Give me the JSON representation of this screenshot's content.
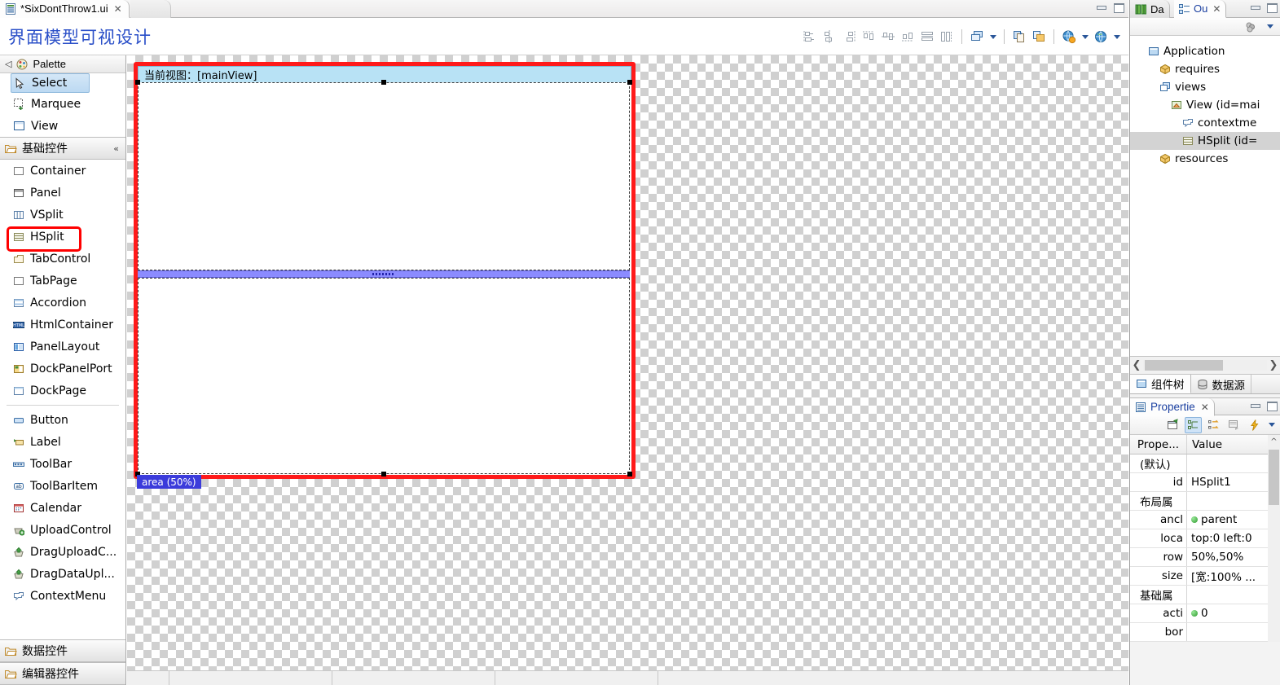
{
  "editor": {
    "tab": {
      "title": "*SixDontThrow1.ui",
      "close": "✕",
      "icon": "file-ui-icon"
    },
    "window_buttons": {
      "minimize": "minimize-icon",
      "maximize": "maximize-icon"
    },
    "heading": "界面模型可视设计",
    "toolbar": {
      "align_left": "align-left-icon",
      "align_center": "align-center-icon",
      "align_right": "align-right-icon",
      "align_top": "align-top-icon",
      "align_middle": "align-middle-icon",
      "align_bottom": "align-bottom-icon",
      "distribute_h": "distribute-horizontal-icon",
      "distribute_v": "distribute-vertical-icon",
      "layers": "layers-icon",
      "copy_style": "copy-style-icon",
      "paste_style": "paste-style-icon",
      "preview": "preview-globe-icon",
      "browser": "browser-globe-icon",
      "dropdown": "chevron-down-icon"
    }
  },
  "palette": {
    "header_label": "Palette",
    "header_icon": "palette-icon",
    "collapse_left": "◁",
    "tools": [
      {
        "label": "Select",
        "icon": "cursor-icon",
        "selected": true
      },
      {
        "label": "Marquee",
        "icon": "marquee-icon",
        "selected": false
      },
      {
        "label": "View",
        "icon": "view-icon",
        "selected": false
      }
    ],
    "groups": [
      {
        "label": "基础控件",
        "icon": "folder-open-icon",
        "collapse_glyph": "«",
        "expanded": true,
        "items": [
          {
            "label": "Container",
            "icon": "container-icon",
            "highlight": false
          },
          {
            "label": "Panel",
            "icon": "panel-icon",
            "highlight": false
          },
          {
            "label": "VSplit",
            "icon": "vsplit-icon",
            "highlight": false
          },
          {
            "label": "HSplit",
            "icon": "hsplit-icon",
            "highlight": true
          },
          {
            "label": "TabControl",
            "icon": "tabcontrol-icon",
            "highlight": false
          },
          {
            "label": "TabPage",
            "icon": "tabpage-icon",
            "highlight": false
          },
          {
            "label": "Accordion",
            "icon": "accordion-icon",
            "highlight": false
          },
          {
            "label": "HtmlContainer",
            "icon": "html-icon",
            "highlight": false
          },
          {
            "label": "PanelLayout",
            "icon": "panellayout-icon",
            "highlight": false
          },
          {
            "label": "DockPanelPort",
            "icon": "dockpanelport-icon",
            "highlight": false
          },
          {
            "label": "DockPage",
            "icon": "dockpage-icon",
            "highlight": false
          }
        ],
        "items2": [
          {
            "label": "Button",
            "icon": "button-icon"
          },
          {
            "label": "Label",
            "icon": "label-icon"
          },
          {
            "label": "ToolBar",
            "icon": "toolbar-icon"
          },
          {
            "label": "ToolBarItem",
            "icon": "toolbaritem-icon"
          },
          {
            "label": "Calendar",
            "icon": "calendar-icon"
          },
          {
            "label": "UploadControl",
            "icon": "upload-icon"
          },
          {
            "label": "DragUploadC...",
            "icon": "drag-upload-icon"
          },
          {
            "label": "DragDataUpl...",
            "icon": "drag-data-upload-icon"
          },
          {
            "label": "ContextMenu",
            "icon": "contextmenu-icon"
          }
        ]
      }
    ],
    "collapsed_groups": [
      {
        "label": "数据控件",
        "icon": "folder-open-icon"
      },
      {
        "label": "编辑器控件",
        "icon": "folder-open-icon"
      }
    ]
  },
  "canvas": {
    "view_caption": "当前视图：[mainView]",
    "area_badge": "area (50%)",
    "selection_color": "#ff1a1a",
    "splitter_color": "#8b8bff",
    "caption_bg": "#b8e2f5"
  },
  "outline": {
    "tabs": [
      {
        "label": "Da",
        "icon": "data-icon",
        "active": false
      },
      {
        "label": "Ou",
        "icon": "outline-icon",
        "active": true,
        "close": "✕"
      }
    ],
    "window_buttons": {
      "minimize": "minimize-icon",
      "maximize": "maximize-icon"
    },
    "toolbar": {
      "filter": "filter-icon",
      "menu": "view-menu-icon"
    },
    "tree": [
      {
        "label": "Application",
        "icon": "application-icon",
        "indent": 0,
        "selected": false
      },
      {
        "label": "requires",
        "icon": "package-icon",
        "indent": 1,
        "selected": false
      },
      {
        "label": "views",
        "icon": "views-icon",
        "indent": 1,
        "selected": false
      },
      {
        "label": "View (id=mai",
        "icon": "view-node-icon",
        "indent": 2,
        "selected": false
      },
      {
        "label": "contextme",
        "icon": "contextmenu-icon",
        "indent": 3,
        "selected": false
      },
      {
        "label": "HSplit (id=",
        "icon": "hsplit-icon",
        "indent": 3,
        "selected": true
      },
      {
        "label": "resources",
        "icon": "package-icon",
        "indent": 1,
        "selected": false
      }
    ],
    "hscroll": {
      "left": "❮",
      "right": "❯"
    },
    "bottom_tabs": [
      {
        "label": "组件树",
        "icon": "component-tree-icon",
        "active": true
      },
      {
        "label": "数据源",
        "icon": "datasource-icon",
        "active": false
      }
    ]
  },
  "properties": {
    "title": "Propertie",
    "close": "✕",
    "window_buttons": {
      "minimize": "minimize-icon",
      "maximize": "maximize-icon"
    },
    "toolbar": {
      "new_tab": "new-tab-icon",
      "show_categories": "show-categories-icon",
      "show_advanced": "show-advanced-icon",
      "restore_default": "restore-default-icon",
      "events": "lightning-icon",
      "menu": "view-menu-icon"
    },
    "columns": {
      "property": "Prope...",
      "value": "Value"
    },
    "rows": [
      {
        "key": "(默认)",
        "value": "",
        "category": true,
        "dot": false
      },
      {
        "key": "id",
        "value": "HSplit1",
        "category": false,
        "dot": false
      },
      {
        "key": "布局属",
        "value": "",
        "category": true,
        "dot": false
      },
      {
        "key": "ancl",
        "value": "parent",
        "category": false,
        "dot": true
      },
      {
        "key": "loca",
        "value": "top:0 left:0",
        "category": false,
        "dot": false
      },
      {
        "key": "row",
        "value": "50%,50%",
        "category": false,
        "dot": false
      },
      {
        "key": "size",
        "value": "[宽:100% ...",
        "category": false,
        "dot": false
      },
      {
        "key": "基础属",
        "value": "",
        "category": true,
        "dot": false
      },
      {
        "key": "acti",
        "value": "0",
        "category": false,
        "dot": true
      },
      {
        "key": "bor",
        "value": "",
        "category": false,
        "dot": false
      }
    ],
    "scroll_up": "^"
  }
}
